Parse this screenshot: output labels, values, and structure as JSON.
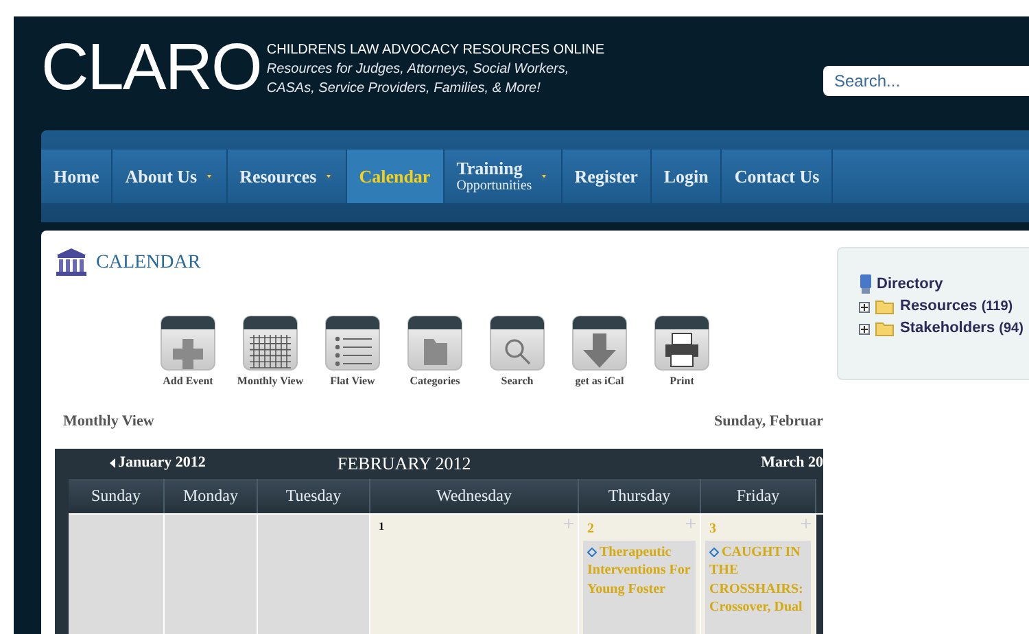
{
  "header": {
    "logo": "CLARO",
    "title": "CHILDRENS LAW ADVOCACY RESOURCES ONLINE",
    "tagline": [
      "Resources for Judges, Attorneys, Social Workers,",
      "CASAs, Service Providers, Families, & More!"
    ],
    "search": {
      "placeholder": "Search..."
    }
  },
  "nav": [
    {
      "label": "Home",
      "selected": false
    },
    {
      "label": "About Us",
      "dropdown": true,
      "selected": false
    },
    {
      "label": "Resources",
      "dropdown": true,
      "selected": false
    },
    {
      "label": "Calendar",
      "selected": true
    },
    {
      "label": "Training",
      "sublabel": "Opportunities",
      "dropdown": true,
      "selected": false
    },
    {
      "label": "Register",
      "selected": false
    },
    {
      "label": "Login",
      "selected": false
    },
    {
      "label": "Contact Us",
      "selected": false
    }
  ],
  "page_title": "CALENDAR",
  "toolbar": [
    {
      "kind": "add",
      "label": "Add Event"
    },
    {
      "kind": "month",
      "label": "Monthly View"
    },
    {
      "kind": "list",
      "label": "Flat View"
    },
    {
      "kind": "folder",
      "label": "Categories"
    },
    {
      "kind": "search",
      "label": "Search"
    },
    {
      "kind": "download",
      "label": "get as iCal"
    },
    {
      "kind": "print",
      "label": "Print"
    }
  ],
  "view_label": "Monthly View",
  "date_label": "Sunday, Februar",
  "calendar": {
    "prev": "January 2012",
    "title": "FEBRUARY 2012",
    "next": "March 20",
    "weekdays": [
      "Sunday",
      "Monday",
      "Tuesday",
      "Wednesday",
      "Thursday",
      "Friday"
    ],
    "cells": [
      {
        "kind": "empty"
      },
      {
        "kind": "empty"
      },
      {
        "kind": "empty"
      },
      {
        "kind": "day",
        "day": "1"
      },
      {
        "kind": "day",
        "day": "2",
        "events": [
          {
            "title": "Therapeutic Interventions For Young Foster"
          }
        ]
      },
      {
        "kind": "day",
        "day": "3",
        "events": [
          {
            "title": "CAUGHT IN THE CROSSHAIRS: Crossover, Dual"
          }
        ]
      }
    ]
  },
  "directory": {
    "title": "Directory",
    "items": [
      {
        "label": "Resources",
        "count": "(119)",
        "expanded": false
      },
      {
        "label": "Stakeholders",
        "count": "(94)",
        "expanded": false
      }
    ]
  }
}
